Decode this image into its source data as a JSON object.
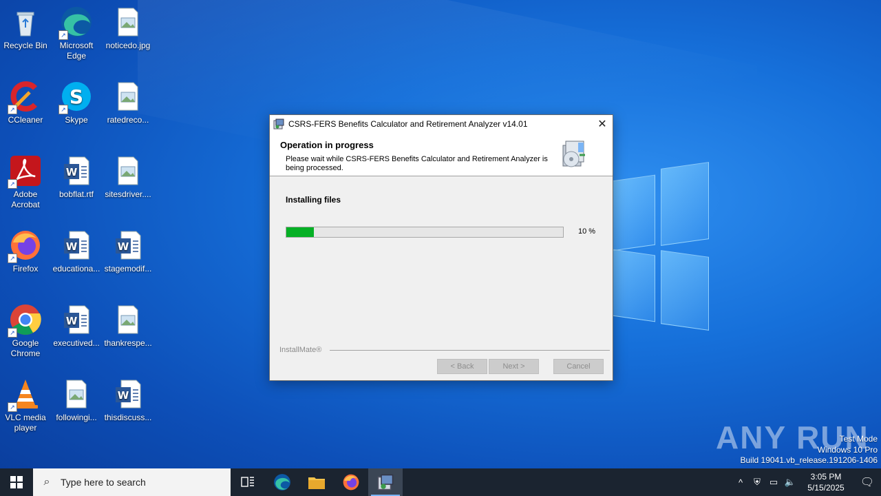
{
  "desktop": {
    "icons": [
      {
        "label": "Recycle Bin"
      },
      {
        "label": "Microsoft Edge"
      },
      {
        "label": "noticedo.jpg"
      },
      {
        "label": "CCleaner"
      },
      {
        "label": "Skype"
      },
      {
        "label": "ratedreco..."
      },
      {
        "label": "Adobe Acrobat"
      },
      {
        "label": "bobflat.rtf"
      },
      {
        "label": "sitesdriver...."
      },
      {
        "label": "Firefox"
      },
      {
        "label": "educationa..."
      },
      {
        "label": "stagemodif..."
      },
      {
        "label": "Google Chrome"
      },
      {
        "label": "executived..."
      },
      {
        "label": "thankrespe..."
      },
      {
        "label": "VLC media player"
      },
      {
        "label": "followingi..."
      },
      {
        "label": "thisdiscuss..."
      }
    ]
  },
  "dialog": {
    "title": "CSRS-FERS Benefits Calculator and Retirement Analyzer v14.01",
    "close_glyph": "✕",
    "header_title": "Operation in progress",
    "header_subtitle": "Please wait while CSRS-FERS Benefits Calculator and Retirement Analyzer is being processed.",
    "section_label": "Installing files",
    "progress_percent": 10,
    "progress_text": "10 %",
    "brand": "InstallMate®",
    "buttons": {
      "back": "< Back",
      "next": "Next >",
      "cancel": "Cancel"
    }
  },
  "watermark": {
    "logo_text": "ANY RUN",
    "lines": [
      "Test Mode",
      "Windows 10 Pro",
      "Build 19041.vb_release.191206-1406"
    ]
  },
  "taskbar": {
    "search_placeholder": "Type here to search",
    "time": "3:05 PM",
    "date": "5/15/2025",
    "accent": "#7ab4f5"
  },
  "colors": {
    "progress_fill": "#06b025",
    "taskbar_bg": "#1b2430",
    "desktop_blue": "#1670da"
  }
}
